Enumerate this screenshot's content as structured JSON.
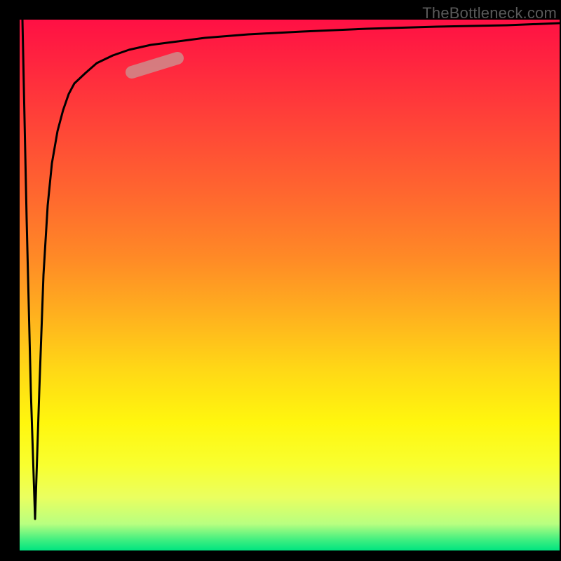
{
  "watermark": "TheBottleneck.com",
  "colors": {
    "frame": "#000000",
    "gradient_top": "#ff1044",
    "gradient_bottom": "#00e480",
    "curve": "#000000",
    "highlight": "#c98282"
  },
  "chart_data": {
    "type": "line",
    "title": "",
    "xlabel": "",
    "ylabel": "",
    "xlim": [
      0,
      100
    ],
    "ylim": [
      0,
      100
    ],
    "x": [
      0,
      0.6,
      1.2,
      1.8,
      2.4,
      3,
      3.6,
      4.2,
      5,
      6,
      7,
      8,
      10,
      12,
      15,
      18,
      22,
      26,
      32,
      40,
      50,
      62,
      75,
      88,
      100
    ],
    "values": [
      100,
      62,
      30,
      6,
      30,
      52,
      65,
      73,
      79,
      83,
      86,
      88,
      90,
      91.8,
      93.3,
      94.3,
      95.2,
      95.8,
      96.5,
      97.2,
      97.8,
      98.3,
      98.7,
      99,
      99.3
    ],
    "highlight_segment": {
      "x_start": 22,
      "x_end": 30,
      "y_start": 95.2,
      "y_end": 96.2
    },
    "annotations": []
  }
}
